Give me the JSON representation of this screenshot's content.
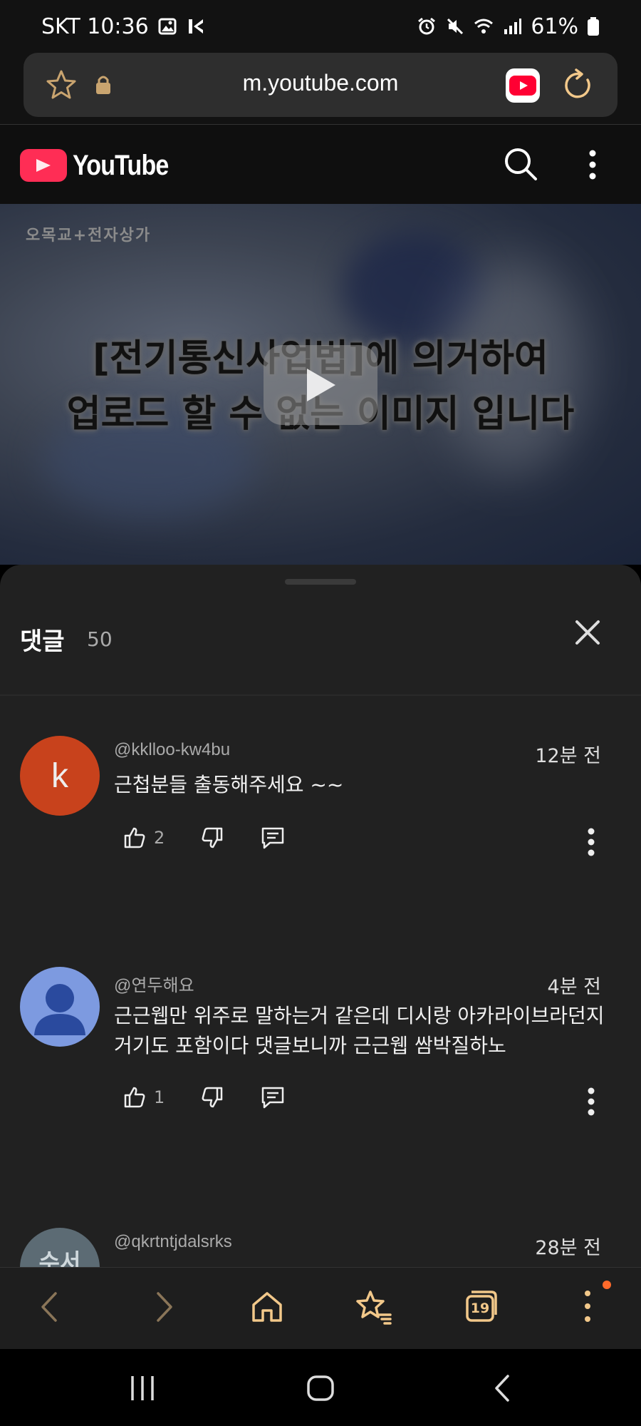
{
  "status_bar": {
    "carrier_time": "SKT 10:36",
    "battery": "61%"
  },
  "url_bar": {
    "url": "m.youtube.com"
  },
  "youtube_header": {
    "logo_text": "YouTube"
  },
  "video": {
    "tag": "오목교+전자상가",
    "caption_line1": "[전기통신사업법]에 의거하여",
    "caption_line2": "업로드 할 수 없는 이미지 입니다"
  },
  "comments_panel": {
    "title": "댓글",
    "count": "50",
    "comments": [
      {
        "author": "@kklloo-kw4bu",
        "time": "12분 전",
        "text": "근첩분들 출동해주세요 ~~",
        "likes": "2",
        "avatar_letter": "k",
        "avatar_color": "#c8421c"
      },
      {
        "author": "@연두해요",
        "time": "4분 전",
        "text": "근근웹만 위주로 말하는거 같은데 디시랑 아카라이브라던지 거기도 포함이다 댓글보니까 근근웹 쌈박질하노",
        "likes": "1",
        "avatar_color": "#7d9ae0"
      },
      {
        "author": "@qkrtntjdalsrks",
        "time": "28분 전",
        "avatar_letter": "수서",
        "avatar_color": "#5c6b74"
      }
    ]
  },
  "colors": {
    "youtube_red": "#ff2d55",
    "browser_accent": "#f2c88a",
    "notification_dot": "#ff6a2b"
  },
  "browser_toolbar": {
    "tabs_count": "19"
  }
}
